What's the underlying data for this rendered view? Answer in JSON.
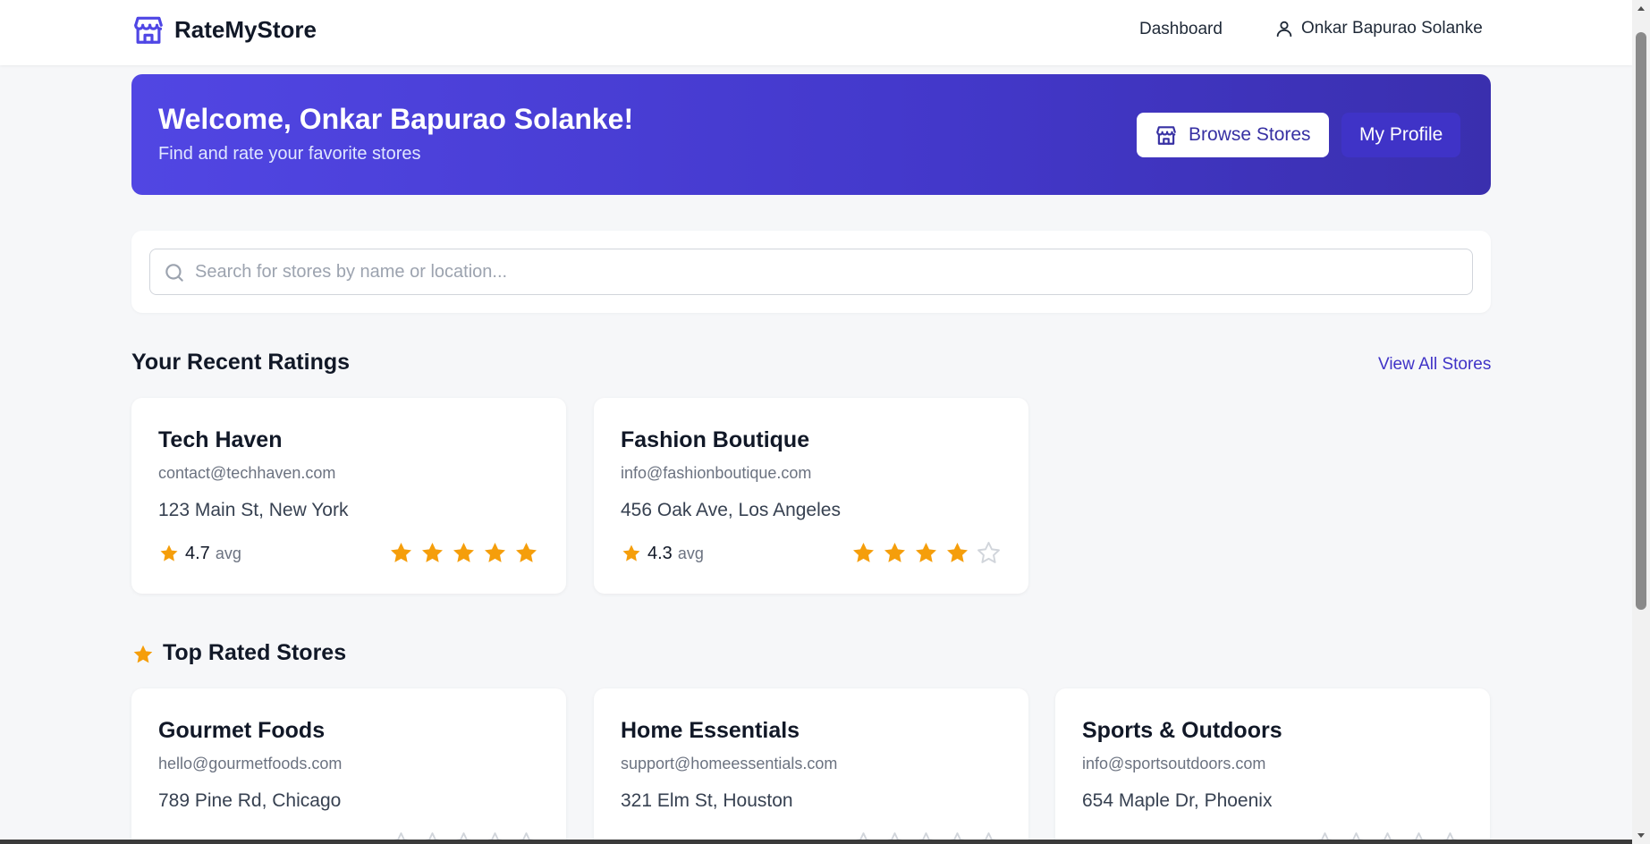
{
  "header": {
    "brand_name": "RateMyStore",
    "brand_icon": "store-icon",
    "nav_dashboard": "Dashboard",
    "user_name": "Onkar Bapurao Solanke",
    "user_icon": "user-icon"
  },
  "banner": {
    "title": "Welcome, Onkar Bapurao Solanke!",
    "subtitle": "Find and rate your favorite stores",
    "browse_label": "Browse Stores",
    "profile_label": "My Profile"
  },
  "search": {
    "placeholder": "Search for stores by name or location...",
    "value": ""
  },
  "recent": {
    "title": "Your Recent Ratings",
    "view_all": "View All Stores",
    "stores": [
      {
        "name": "Tech Haven",
        "email": "contact@techhaven.com",
        "address": "123 Main St, New York",
        "avg": "4.7",
        "avg_label": "avg",
        "user_rating": 5
      },
      {
        "name": "Fashion Boutique",
        "email": "info@fashionboutique.com",
        "address": "456 Oak Ave, Los Angeles",
        "avg": "4.3",
        "avg_label": "avg",
        "user_rating": 4
      }
    ]
  },
  "top": {
    "title": "Top Rated Stores",
    "stores": [
      {
        "name": "Gourmet Foods",
        "email": "hello@gourmetfoods.com",
        "address": "789 Pine Rd, Chicago",
        "user_rating": 0
      },
      {
        "name": "Home Essentials",
        "email": "support@homeessentials.com",
        "address": "321 Elm St, Houston",
        "user_rating": 0
      },
      {
        "name": "Sports & Outdoors",
        "email": "info@sportsoutdoors.com",
        "address": "654 Maple Dr, Phoenix",
        "user_rating": 0
      }
    ]
  },
  "colors": {
    "accent": "#4338ca",
    "star_filled": "#f59e0b",
    "star_empty": "#d1d5db",
    "background": "#f6f7f9"
  }
}
